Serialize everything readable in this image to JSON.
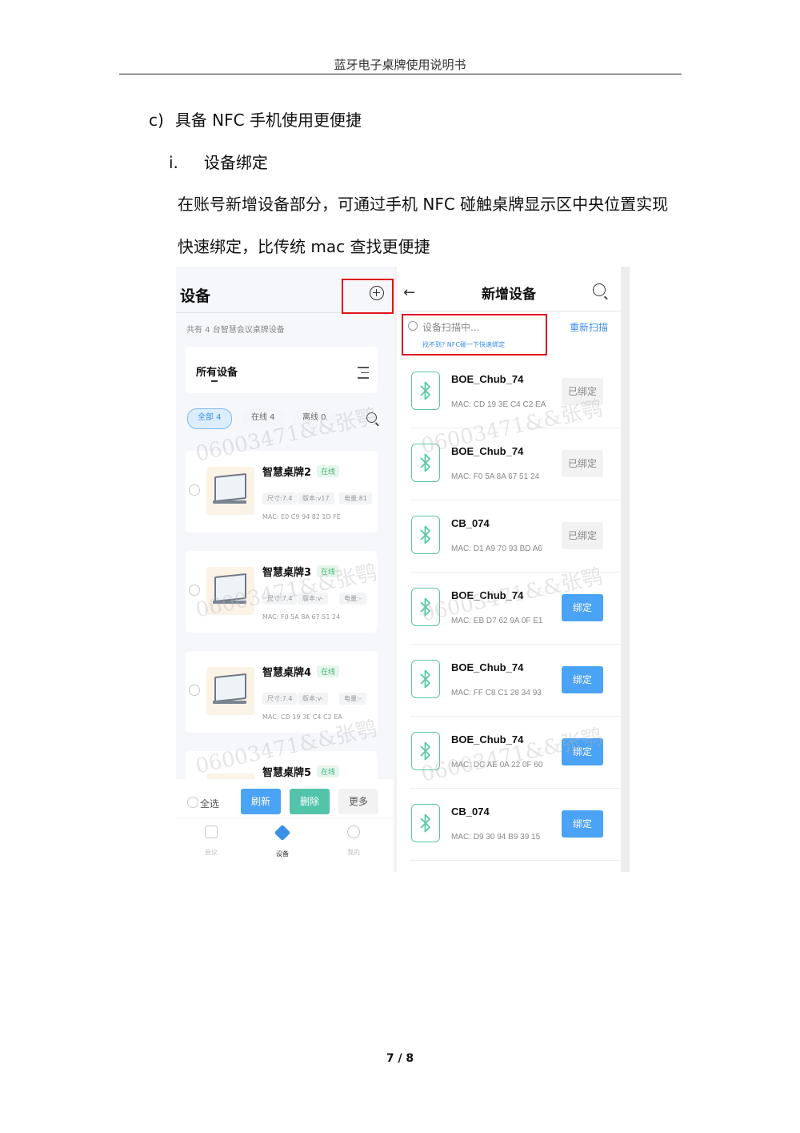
{
  "doc": {
    "header": "蓝牙电子桌牌使用说明书",
    "section_c_marker": "c)",
    "section_c_title": "具备 NFC 手机使用更便捷",
    "section_i_marker": "i.",
    "section_i_title": "设备绑定",
    "para_line1": "在账号新增设备部分，可通过手机 NFC 碰触桌牌显示区中央位置实现",
    "para_line2": "快速绑定，比传统 mac 查找更便捷",
    "page": "7 / 8"
  },
  "left": {
    "title": "设备",
    "count": "共有 4 台智慧会议桌牌设备",
    "all_devices": "所有设备",
    "filters": [
      "全部 4",
      "在线 4",
      "离线 0"
    ],
    "watermark": "06003471&&张鹗",
    "devices": [
      {
        "name": "智慧桌牌2",
        "status": "在线",
        "size": "尺寸:7.4",
        "version": "版本:v17",
        "battery": "电量:81",
        "mac": "MAC: E0 C9 94 82 1D FE"
      },
      {
        "name": "智慧桌牌3",
        "status": "在线",
        "size": "尺寸:7.4",
        "version": "版本:v-",
        "battery": "电量:-",
        "mac": "MAC: F0 5A 8A 67 51 24"
      },
      {
        "name": "智慧桌牌4",
        "status": "在线",
        "size": "尺寸:7.4",
        "version": "版本:v-",
        "battery": "电量:-",
        "mac": "MAC: CD 19 3E C4 C2 EA"
      },
      {
        "name": "智慧桌牌5",
        "status": "在线"
      }
    ],
    "select_all": "全选",
    "refresh": "刷新",
    "delete": "删除",
    "more": "更多",
    "tabs": [
      "会议",
      "设备",
      "我的"
    ]
  },
  "right": {
    "back": "←",
    "title": "新增设备",
    "scanning": "设备扫描中...",
    "nfc_hint": "找不到? NFC碰一下快速绑定",
    "rescan": "重新扫描",
    "watermark": "06003471&&张鹗",
    "devices": [
      {
        "name": "BOE_Chub_74",
        "mac": "MAC: CD 19 3E C4 C2 EA",
        "action": "已绑定",
        "bound": true
      },
      {
        "name": "BOE_Chub_74",
        "mac": "MAC: F0 5A 8A 67 51 24",
        "action": "已绑定",
        "bound": true
      },
      {
        "name": "CB_074",
        "mac": "MAC: D1 A9 70 93 BD A6",
        "action": "已绑定",
        "bound": true
      },
      {
        "name": "BOE_Chub_74",
        "mac": "MAC: EB D7 62 9A 0F E1",
        "action": "绑定",
        "bound": false
      },
      {
        "name": "BOE_Chub_74",
        "mac": "MAC: FF C8 C1 28 34 93",
        "action": "绑定",
        "bound": false
      },
      {
        "name": "BOE_Chub_74",
        "mac": "MAC: DC AE 0A 22 0F 60",
        "action": "绑定",
        "bound": false
      },
      {
        "name": "CB_074",
        "mac": "MAC: D9 30 94 B9 39 15",
        "action": "绑定",
        "bound": false
      }
    ]
  },
  "colors": {
    "highlight_red": "#e0141e",
    "accent_blue": "#4aa3f4",
    "accent_teal": "#53c3aa",
    "bluetooth_green": "#5cc6a4"
  }
}
